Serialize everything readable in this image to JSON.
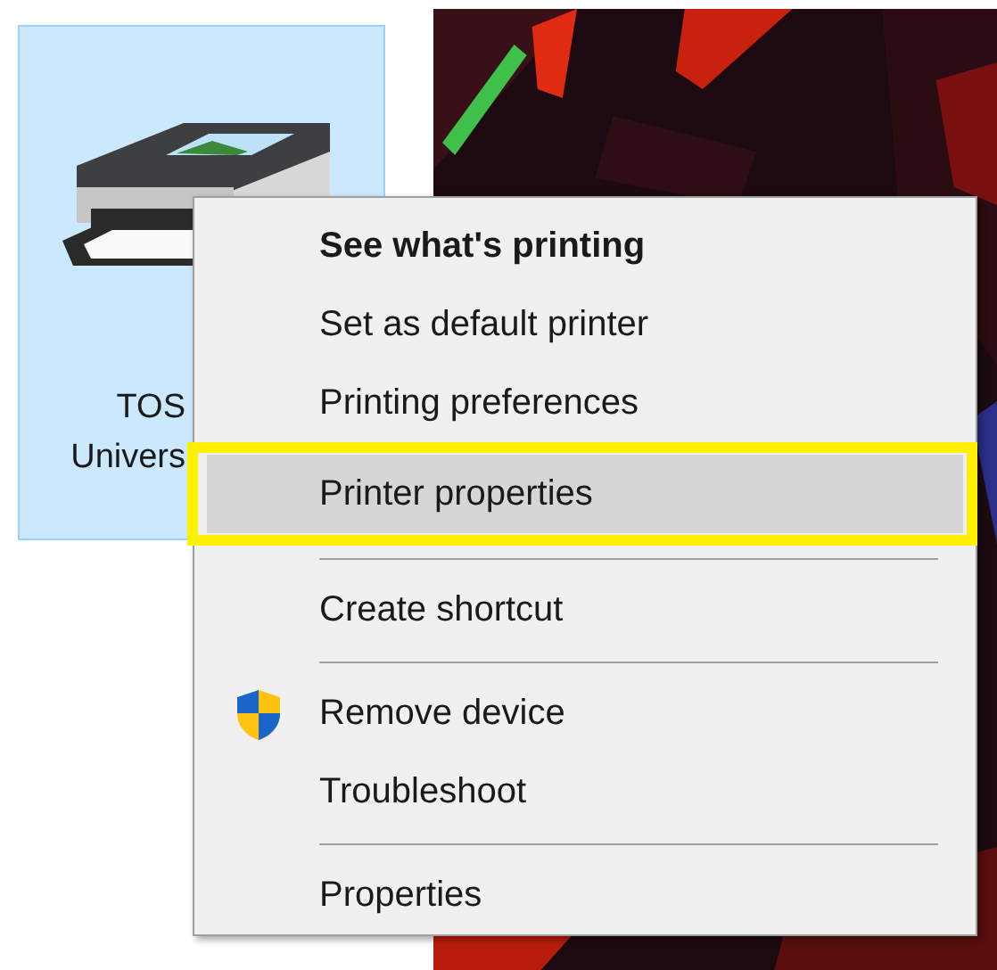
{
  "device": {
    "label_lines": [
      "TOS",
      "Univers"
    ],
    "selected": true
  },
  "context_menu": {
    "groups": [
      [
        {
          "label": "See what's printing",
          "kind": "default",
          "selected": false,
          "outlined": false
        },
        {
          "label": "Set as default printer",
          "kind": "command",
          "selected": false,
          "outlined": false
        },
        {
          "label": "Printing preferences",
          "kind": "command",
          "selected": false,
          "outlined": false
        },
        {
          "label": "Printer properties",
          "kind": "command",
          "selected": true,
          "outlined": true
        }
      ],
      [
        {
          "label": "Create shortcut",
          "kind": "command",
          "selected": false,
          "outlined": false
        }
      ],
      [
        {
          "label": "Remove device",
          "kind": "shield",
          "selected": false,
          "outlined": false
        },
        {
          "label": "Troubleshoot",
          "kind": "command",
          "selected": false,
          "outlined": false
        }
      ],
      [
        {
          "label": "Properties",
          "kind": "command",
          "selected": false,
          "outlined": false
        }
      ]
    ]
  }
}
